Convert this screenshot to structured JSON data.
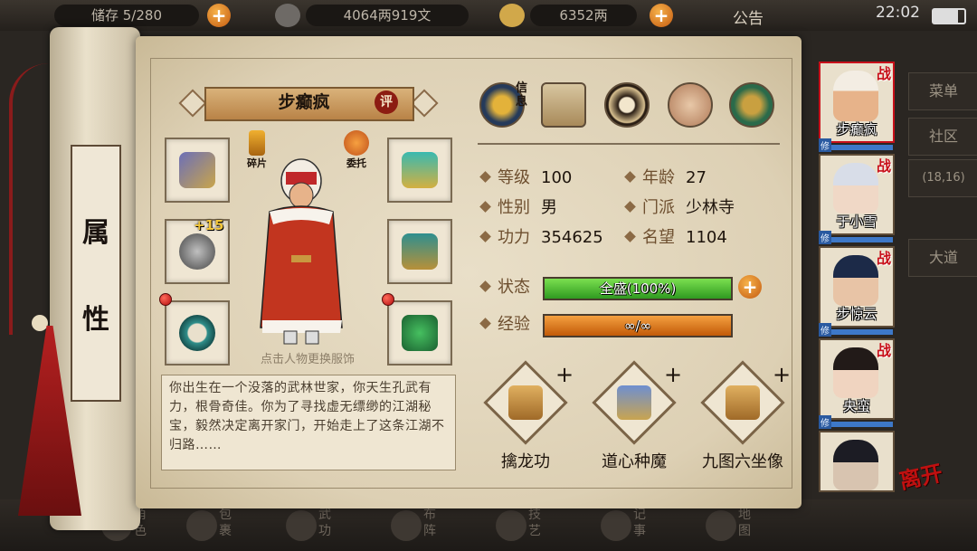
{
  "status_bar": {
    "bag": "储存 5/280",
    "copper": "4064两919文",
    "silver": "6352两",
    "notice": "公告",
    "clock": "22:02"
  },
  "side_menu": [
    "菜单",
    "社区",
    "(18,16)",
    "大道"
  ],
  "bottom_nav": [
    "角色",
    "包裹",
    "武功",
    "布阵",
    "技艺",
    "记事",
    "地图"
  ],
  "attribute_tab": {
    "char1": "属",
    "char2": "性"
  },
  "character": {
    "name": "步癫疯",
    "rate_label": "评",
    "fragment_label": "碎片",
    "entrust_label": "委托",
    "plus_level": "+15",
    "change_outfit_hint": "点击人物更换服饰",
    "description": "你出生在一个没落的武林世家，你天生孔武有力，根骨奇佳。你为了寻找虚无缥缈的江湖秘宝，毅然决定离开家门，开始走上了这条江湖不归路……"
  },
  "info_icons": {
    "first_label": "信息"
  },
  "stats": {
    "level_label": "等级",
    "level": "100",
    "age_label": "年龄",
    "age": "27",
    "gender_label": "性别",
    "gender": "男",
    "sect_label": "门派",
    "sect": "少林寺",
    "power_label": "功力",
    "power": "354625",
    "fame_label": "名望",
    "fame": "1104",
    "state_label": "状态",
    "state_text": "全盛(100%)",
    "state_percent": 100,
    "exp_label": "经验",
    "exp_text": "∞/∞",
    "exp_percent": 100
  },
  "skills": [
    {
      "name": "擒龙功",
      "plus": "+"
    },
    {
      "name": "道心种魔",
      "plus": "+"
    },
    {
      "name": "九图六坐像",
      "plus": "+"
    }
  ],
  "party": [
    {
      "name": "步癫疯",
      "tag": "战",
      "xiu": "修"
    },
    {
      "name": "于小雪",
      "tag": "战",
      "xiu": "修"
    },
    {
      "name": "步惊云",
      "tag": "战",
      "xiu": "修"
    },
    {
      "name": "央蛮",
      "tag": "战",
      "xiu": "修"
    },
    {
      "name": "",
      "tag": "",
      "xiu": ""
    }
  ],
  "leave_label": "离开",
  "colors": {
    "state_bar": "#3fae2a",
    "exp_bar": "#e07814",
    "accent_red": "#c8101a"
  }
}
